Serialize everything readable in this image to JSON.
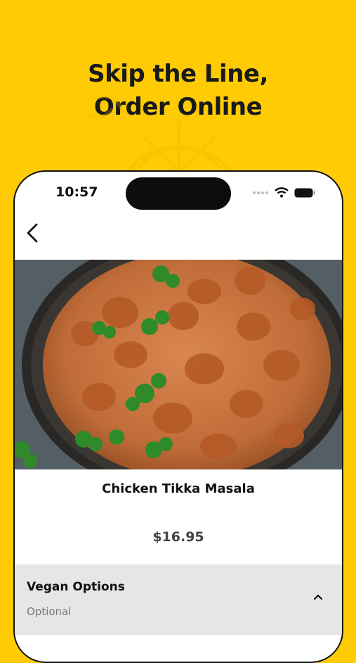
{
  "headline": {
    "line1": "Skip the Line,",
    "line2": "Order Online"
  },
  "colors": {
    "background": "#FFCB05",
    "text": "#1a1a1a",
    "option_bg": "#e6e6e6"
  },
  "status_bar": {
    "time": "10:57",
    "icons": [
      "signal-dots-icon",
      "wifi-icon",
      "battery-icon"
    ]
  },
  "nav": {
    "back_icon": "chevron-left-icon"
  },
  "item": {
    "image_alt": "Chicken Tikka Masala in a cast iron pan",
    "name": "Chicken Tikka Masala",
    "price": "$16.95"
  },
  "options": [
    {
      "title": "Vegan Options",
      "subtitle": "Optional",
      "expanded": true
    }
  ]
}
